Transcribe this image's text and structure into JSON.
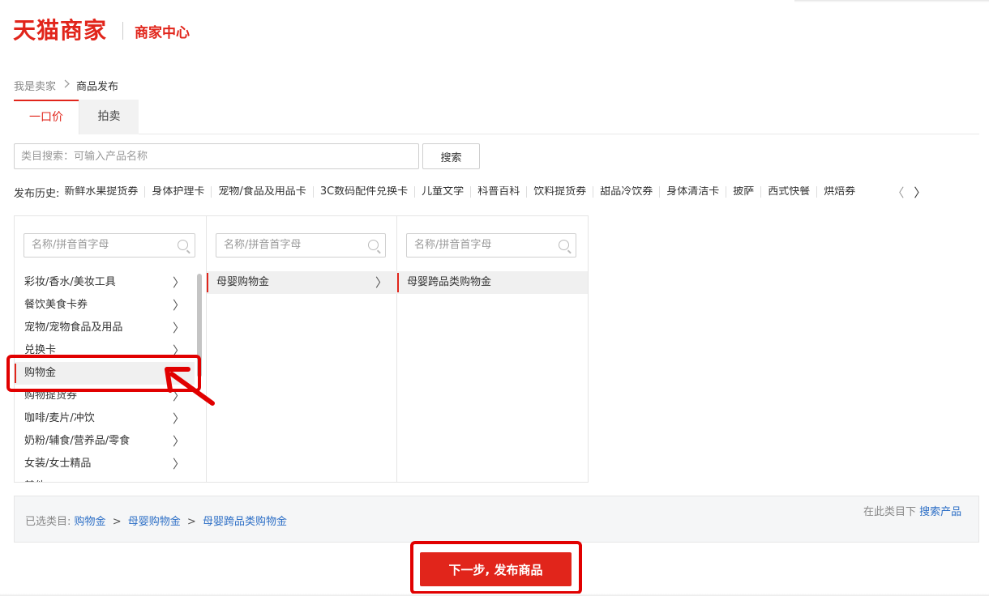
{
  "header": {
    "logo": "天猫商家",
    "title": "商家中心"
  },
  "breadcrumb": {
    "parent": "我是卖家",
    "current": "商品发布"
  },
  "tabs": [
    {
      "label": "一口价"
    },
    {
      "label": "拍卖"
    }
  ],
  "search": {
    "placeholder": "类目搜索：可输入产品名称",
    "button": "搜索"
  },
  "history": {
    "label": "发布历史:",
    "items": [
      "新鲜水果提货券",
      "身体护理卡",
      "宠物/食品及用品卡",
      "3C数码配件兑换卡",
      "儿童文学",
      "科普百科",
      "饮料提货券",
      "甜品冷饮券",
      "身体清洁卡",
      "披萨",
      "西式快餐",
      "烘焙券"
    ],
    "prev": "〈",
    "next": "〉"
  },
  "columns": [
    {
      "placeholder": "名称/拼音首字母",
      "items": [
        {
          "label": "彩妆/香水/美妆工具",
          "arrow": "〉"
        },
        {
          "label": "餐饮美食卡券",
          "arrow": "〉"
        },
        {
          "label": "宠物/宠物食品及用品",
          "arrow": "〉"
        },
        {
          "label": "兑换卡",
          "arrow": "〉"
        },
        {
          "label": "购物金",
          "arrow": ""
        },
        {
          "label": "购物提货券",
          "arrow": "〉"
        },
        {
          "label": "咖啡/麦片/冲饮",
          "arrow": "〉"
        },
        {
          "label": "奶粉/辅食/营养品/零食",
          "arrow": "〉"
        },
        {
          "label": "女装/女士精品",
          "arrow": "〉"
        },
        {
          "label": "其他",
          "arrow": ""
        }
      ]
    },
    {
      "placeholder": "名称/拼音首字母",
      "items": [
        {
          "label": "母婴购物金",
          "arrow": "〉"
        }
      ]
    },
    {
      "placeholder": "名称/拼音首字母",
      "items": [
        {
          "label": "母婴跨品类购物金",
          "arrow": ""
        }
      ]
    }
  ],
  "selected": {
    "label": "已选类目:",
    "path": [
      "购物金",
      "母婴购物金",
      "母婴跨品类购物金"
    ],
    "separator": ">",
    "right_text": "在此类目下",
    "right_link": "搜索产品"
  },
  "next_button": "下一步, 发布商品",
  "colors": {
    "brand": "#e1251b",
    "link": "#2d6fc6",
    "annotation": "#e10000"
  },
  "icons": [
    "search-icon",
    "chevron-right-icon",
    "arrow-annotation"
  ]
}
